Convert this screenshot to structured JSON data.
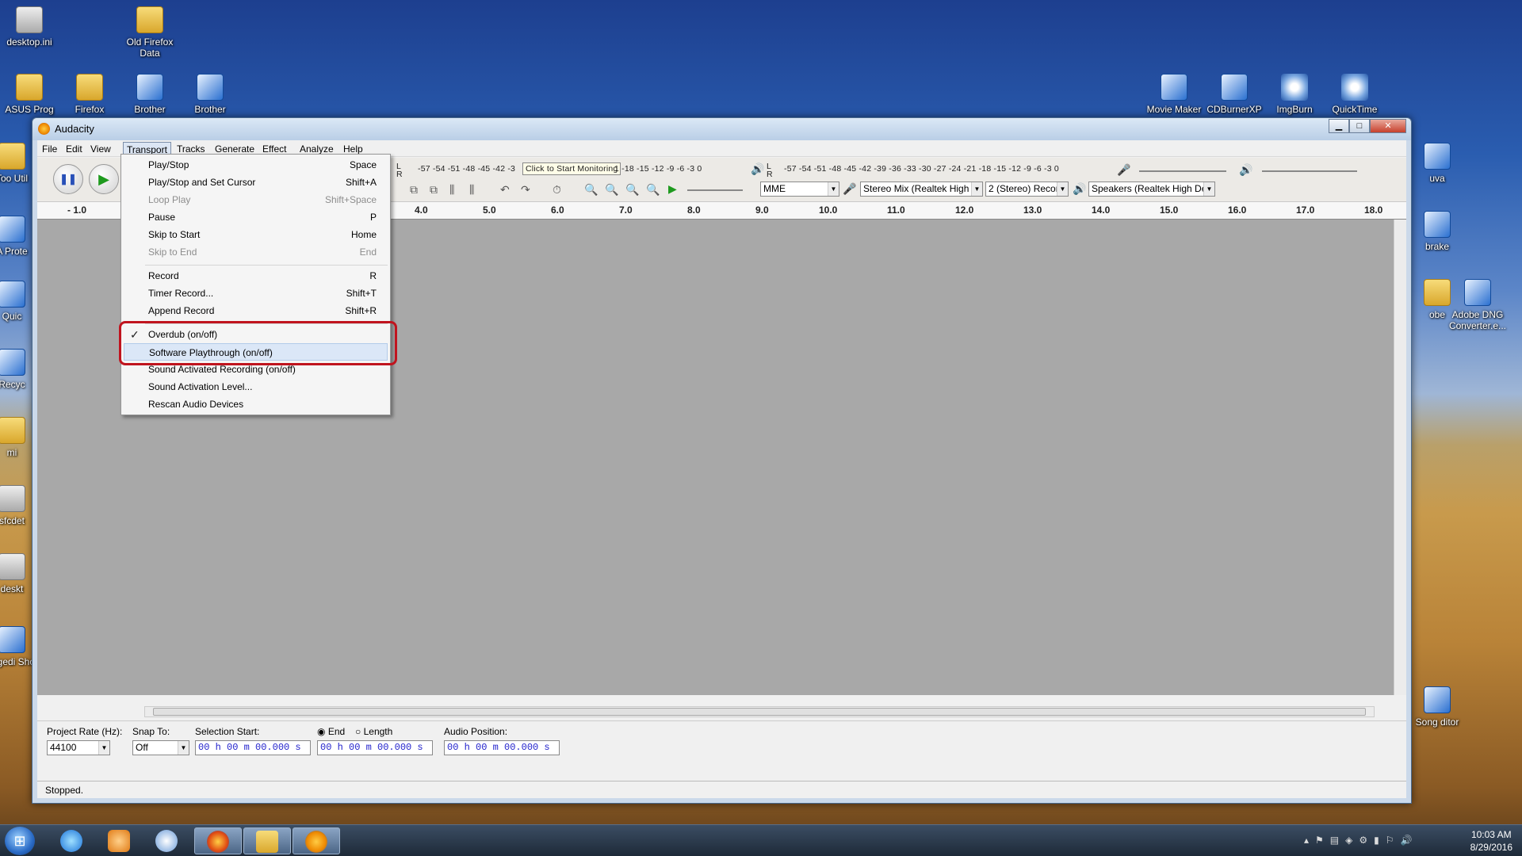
{
  "desktop": {
    "icons": [
      {
        "label": "desktop.ini",
        "type": "ini"
      },
      {
        "label": "Old Firefox Data",
        "type": "folder"
      },
      {
        "label": "ASUS Prog",
        "type": "folder"
      },
      {
        "label": "Firefox",
        "type": "folder"
      },
      {
        "label": "Brother",
        "type": "app"
      },
      {
        "label": "Brother",
        "type": "app"
      },
      {
        "label": "Movie Maker",
        "type": "app"
      },
      {
        "label": "CDBurnerXP",
        "type": "app"
      },
      {
        "label": "ImgBurn",
        "type": "app2"
      },
      {
        "label": "QuickTime",
        "type": "app2"
      },
      {
        "label": "Adobe DNG Converter.e...",
        "type": "app"
      },
      {
        "label": "Too Util",
        "type": "folder"
      },
      {
        "label": "A Prote",
        "type": "app"
      },
      {
        "label": "Quic",
        "type": "app"
      },
      {
        "label": "Recyc",
        "type": "app"
      },
      {
        "label": "mi",
        "type": "folder"
      },
      {
        "label": "sfcdet",
        "type": "ini"
      },
      {
        "label": "deskt",
        "type": "ini"
      },
      {
        "label": "regedi Sho",
        "type": "app"
      },
      {
        "label": "uva",
        "type": "app"
      },
      {
        "label": "brake",
        "type": "app"
      },
      {
        "label": "obe",
        "type": "folder"
      },
      {
        "label": "Song ditor",
        "type": "app"
      }
    ]
  },
  "window": {
    "title": "Audacity",
    "min": "▁",
    "max": "□",
    "close": "✕"
  },
  "menubar": [
    "File",
    "Edit",
    "View",
    "Transport",
    "Tracks",
    "Generate",
    "Effect",
    "Analyze",
    "Help"
  ],
  "toolbar": {
    "rec_meter_scale": "-57 -54 -51 -48 -45 -42 -3",
    "monitor_tip": "Click to Start Monitoring",
    "rec_meter_scale_tail": "1 -18 -15 -12  -9  -6  -3  0",
    "play_meter_scale": "-57 -54 -51 -48 -45 -42 -39 -36 -33 -30 -27 -24 -21 -18 -15 -12  -9  -6  -3  0",
    "lr": "L R",
    "host": "MME",
    "rec_device": "Stereo Mix (Realtek High D",
    "channels": "2 (Stereo) Recor",
    "play_device": "Speakers (Realtek High De"
  },
  "ruler": {
    "labels": [
      "- 1.0",
      "4.0",
      "5.0",
      "6.0",
      "7.0",
      "8.0",
      "9.0",
      "10.0",
      "11.0",
      "12.0",
      "13.0",
      "14.0",
      "15.0",
      "16.0",
      "17.0",
      "18.0"
    ]
  },
  "transport_menu": {
    "items": [
      {
        "label": "Play/Stop",
        "shortcut": "Space",
        "disabled": false
      },
      {
        "label": "Play/Stop and Set Cursor",
        "shortcut": "Shift+A",
        "disabled": false
      },
      {
        "label": "Loop Play",
        "shortcut": "Shift+Space",
        "disabled": true
      },
      {
        "label": "Pause",
        "shortcut": "P",
        "disabled": false
      },
      {
        "label": "Skip to Start",
        "shortcut": "Home",
        "disabled": false
      },
      {
        "label": "Skip to End",
        "shortcut": "End",
        "disabled": true
      },
      {
        "label": "Record",
        "shortcut": "R",
        "disabled": false
      },
      {
        "label": "Timer Record...",
        "shortcut": "Shift+T",
        "disabled": false
      },
      {
        "label": "Append Record",
        "shortcut": "Shift+R",
        "disabled": false
      },
      {
        "label": "Overdub (on/off)",
        "shortcut": "",
        "disabled": false,
        "checked": true
      },
      {
        "label": "Software Playthrough (on/off)",
        "shortcut": "",
        "disabled": false,
        "highlighted": true
      },
      {
        "label": "Sound Activated Recording (on/off)",
        "shortcut": "",
        "disabled": false
      },
      {
        "label": "Sound Activation Level...",
        "shortcut": "",
        "disabled": false
      },
      {
        "label": "Rescan Audio Devices",
        "shortcut": "",
        "disabled": false
      }
    ],
    "check_mark": "✓"
  },
  "selection_toolbar": {
    "project_rate_label": "Project Rate (Hz):",
    "project_rate": "44100",
    "snap_label": "Snap To:",
    "snap": "Off",
    "sel_start_label": "Selection Start:",
    "sel_start": "00 h 00 m 00.000 s",
    "end_label": "End",
    "length_label": "Length",
    "sel_end": "00 h 00 m 00.000 s",
    "audio_pos_label": "Audio Position:",
    "audio_pos": "00 h 00 m 00.000 s"
  },
  "status": "Stopped.",
  "taskbar": {
    "time": "10:03 AM",
    "date": "8/29/2016"
  },
  "colors": {
    "highlight_box": "#c0141e",
    "timecode": "#2222cc"
  }
}
